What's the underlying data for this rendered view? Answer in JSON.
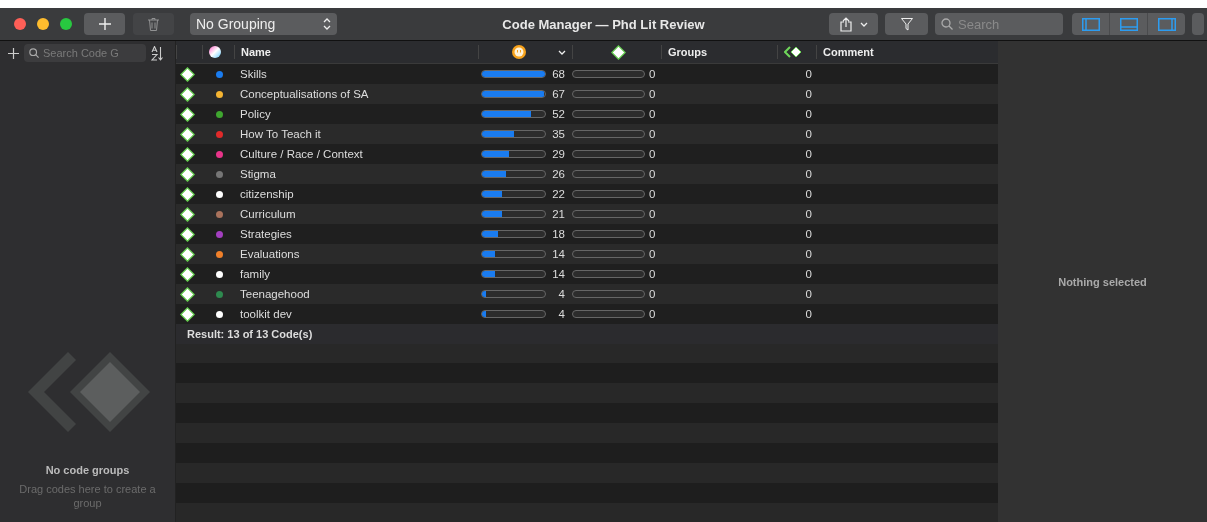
{
  "window": {
    "title": "Code Manager — Phd Lit Review"
  },
  "toolbar": {
    "grouping": "No Grouping",
    "search_placeholder": "Search",
    "delete_disabled": true
  },
  "sidebar": {
    "search_placeholder": "Search Code G",
    "empty_title": "No code groups",
    "empty_hint": "Drag codes here to create a group"
  },
  "table": {
    "columns": [
      "Name",
      "Groups",
      "Comment"
    ],
    "rows": [
      {
        "name": "Skills",
        "color": "#1a7cf0",
        "count": "68",
        "level": 1,
        "count_2": "0",
        "meter_2": {
          "level": 0
        },
        "count_3": "0"
      },
      {
        "name": "Conceptualisations of SA",
        "color": "#f5b431",
        "count": "67",
        "level": 0.99,
        "count_2": "0",
        "meter_2": {
          "level": 0
        },
        "count_3": "0"
      },
      {
        "name": "Policy",
        "color": "#3fa62f",
        "count": "52",
        "level": 0.77,
        "count_2": "0",
        "meter_2": {
          "level": 0
        },
        "count_3": "0"
      },
      {
        "name": "How To Teach it",
        "color": "#e02a2a",
        "count": "35",
        "level": 0.51,
        "count_2": "0",
        "meter_2": {
          "level": 0
        },
        "count_3": "0"
      },
      {
        "name": "Culture / Race / Context",
        "color": "#e8348a",
        "count": "29",
        "level": 0.43,
        "count_2": "0",
        "meter_2": {
          "level": 0
        },
        "count_3": "0"
      },
      {
        "name": "Stigma",
        "color": "#767676",
        "count": "26",
        "level": 0.38,
        "count_2": "0",
        "meter_2": {
          "level": 0
        },
        "count_3": "0"
      },
      {
        "name": "citizenship",
        "color": "#ffffff",
        "count": "22",
        "level": 0.32,
        "count_2": "0",
        "meter_2": {
          "level": 0
        },
        "count_3": "0"
      },
      {
        "name": "Curriculum",
        "color": "#a9725c",
        "count": "21",
        "level": 0.31,
        "count_2": "0",
        "meter_2": {
          "level": 0
        },
        "count_3": "0"
      },
      {
        "name": "Strategies",
        "color": "#a33fc0",
        "count": "18",
        "level": 0.26,
        "count_2": "0",
        "meter_2": {
          "level": 0
        },
        "count_3": "0"
      },
      {
        "name": "Evaluations",
        "color": "#f0802a",
        "count": "14",
        "level": 0.21,
        "count_2": "0",
        "meter_2": {
          "level": 0
        },
        "count_3": "0"
      },
      {
        "name": "family",
        "color": "#ffffff",
        "count": "14",
        "level": 0.21,
        "count_2": "0",
        "meter_2": {
          "level": 0
        },
        "count_3": "0"
      },
      {
        "name": "Teenagehood",
        "color": "#2e8a4f",
        "count": "4",
        "level": 0.06,
        "count_2": "0",
        "meter_2": {
          "level": 0
        },
        "count_3": "0"
      },
      {
        "name": "toolkit dev",
        "color": "#ffffff",
        "count": "4",
        "level": 0.06,
        "count_2": "0",
        "meter_2": {
          "level": 0
        },
        "count_3": "0"
      }
    ],
    "result": "Result: 13 of 13 Code(s)"
  },
  "detail": {
    "placeholder": "Nothing selected"
  }
}
